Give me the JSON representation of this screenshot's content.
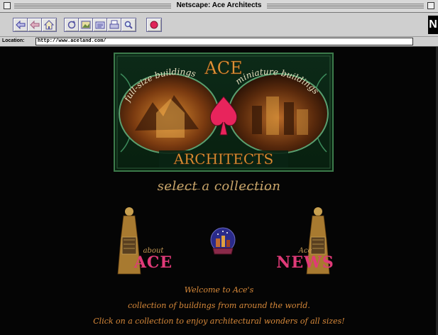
{
  "window": {
    "title": "Netscape: Ace Architects"
  },
  "toolbar": {
    "buttons": [
      {
        "name": "back-button",
        "icon": "back-arrow-icon"
      },
      {
        "name": "forward-button",
        "icon": "forward-arrow-icon"
      },
      {
        "name": "home-button",
        "icon": "home-icon"
      },
      {
        "name": "reload-button",
        "icon": "reload-icon"
      },
      {
        "name": "images-button",
        "icon": "images-icon"
      },
      {
        "name": "open-button",
        "icon": "open-icon"
      },
      {
        "name": "print-button",
        "icon": "print-icon"
      },
      {
        "name": "find-button",
        "icon": "find-icon"
      },
      {
        "name": "stop-button",
        "icon": "stop-icon"
      }
    ],
    "logo": "N"
  },
  "location": {
    "label": "Location:",
    "url": "http://www.aceland.com/"
  },
  "banner": {
    "top_word": "ACE",
    "bottom_word": "ARCHITECTS",
    "left_arc": "full-size buildings",
    "right_arc": "miniature buildings"
  },
  "select_collection": "select a collection",
  "about": {
    "small": "about",
    "big": "ACE"
  },
  "news": {
    "small": "Ace",
    "big": "NEWS"
  },
  "welcome": [
    "Welcome to Ace's",
    "collection of buildings from around the world.",
    "Click on a collection to enjoy architectural wonders of all sizes!"
  ],
  "colors": {
    "accent_pink": "#e03a78",
    "gold": "#c9a56a",
    "banner_green": "#0f3a22"
  }
}
